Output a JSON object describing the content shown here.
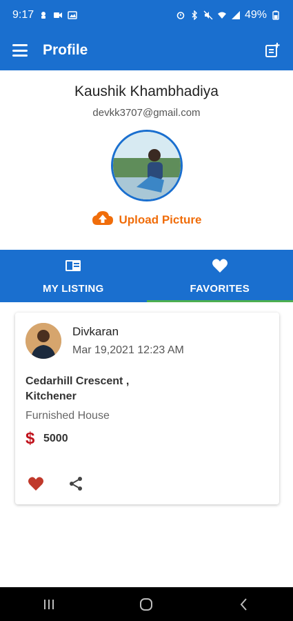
{
  "status_bar": {
    "time": "9:17",
    "battery": "49%",
    "left_icons": [
      "notification-icon",
      "video-icon",
      "gallery-icon"
    ],
    "right_icons": [
      "alarm-icon",
      "bluetooth-icon",
      "mute-icon",
      "wifi-icon",
      "signal-icon",
      "battery-icon"
    ]
  },
  "app_bar": {
    "title": "Profile",
    "menu_icon": "hamburger-icon",
    "action_icon": "add-note-icon",
    "color": "#1a6fcf"
  },
  "profile": {
    "name": "Kaushik Khambhadiya",
    "email": "devkk3707@gmail.com",
    "upload_label": "Upload Picture",
    "upload_color": "#f06d0a"
  },
  "tabs": [
    {
      "label": "MY LISTING",
      "icon": "listing-icon",
      "active": false
    },
    {
      "label": "FAVORITES",
      "icon": "heart-icon",
      "active": true
    }
  ],
  "listing": {
    "user_name": "Divkaran",
    "date": "Mar 19,2021 12:23 AM",
    "address": "Cedarhill Crescent , Kitchener",
    "type": "Furnished House",
    "currency": "$",
    "price": "5000",
    "favorite_icon": "heart-icon",
    "share_icon": "share-icon",
    "favorite_color": "#c0392b"
  },
  "nav_bar": [
    "recent-apps-icon",
    "home-icon",
    "back-icon"
  ]
}
